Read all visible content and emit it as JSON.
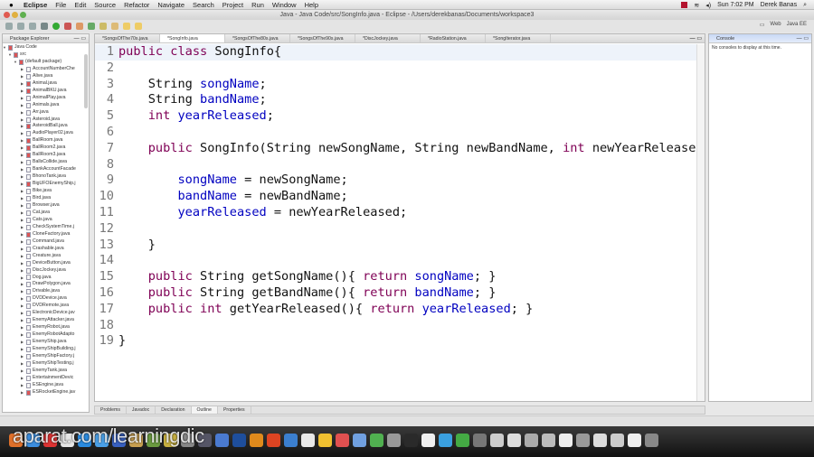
{
  "menubar": {
    "app": "Eclipse",
    "items": [
      "File",
      "Edit",
      "Source",
      "Refactor",
      "Navigate",
      "Search",
      "Project",
      "Run",
      "Window",
      "Help"
    ],
    "clock": "Sun 7:02 PM",
    "user": "Derek Banas"
  },
  "window": {
    "title": "Java - Java Code/src/SongInfo.java - Eclipse - /Users/derekbanas/Documents/workspace3"
  },
  "perspectives": {
    "web": "Web",
    "javaee": "Java EE"
  },
  "package_explorer": {
    "title": "Package Explorer",
    "project": "Java Code",
    "src": "src",
    "package": "(default package)",
    "files": [
      "AccountNumberChe",
      "Alive.java",
      "Animal.java",
      "AnimalBKU.java",
      "AnimalPlay.java",
      "Animals.java",
      "Arr.java",
      "Asteroid.java",
      "AsteroidBall.java",
      "AudioPlayer02.java",
      "BallRoom.java",
      "BallRoom2.java",
      "BallRoom3.java",
      "BallsCollide.java",
      "BankAccountFacade",
      "BhonoTank.java",
      "BigUFOEnemyShip.j",
      "Bike.java",
      "Bird.java",
      "Browser.java",
      "Cat.java",
      "Cats.java",
      "CheckSystemTime.j",
      "CloneFactory.java",
      "Command.java",
      "Crashable.java",
      "Creature.java",
      "DeviceButton.java",
      "DiscJockey.java",
      "Dog.java",
      "DrawPolygon.java",
      "Drivable.java",
      "DVDDevice.java",
      "DVDRemote.java",
      "ElectronicDevice.jav",
      "EnemyAttacker.java",
      "EnemyRobot.java",
      "EnemyRobotAdapto",
      "EnemyShip.java",
      "EnemyShipBuilding.j",
      "EnemyShipFactory.j",
      "EnemyShipTesting.j",
      "EnemyTank.java",
      "EntertainmentDevic",
      "ESEngine.java",
      "ESRocketEngine.jav"
    ],
    "error_files": [
      2,
      3,
      8,
      10,
      11,
      12,
      16,
      23,
      45
    ]
  },
  "editor": {
    "tabs": [
      "*SongsOfThe70s.java",
      "*SongInfo.java",
      "*SongsOfThe80s.java",
      "*SongsOfThe90s.java",
      "*DiscJockey.java",
      "*RadioStation.java",
      "*SongIterator.java"
    ],
    "active_tab": 1,
    "lines": [
      [
        [
          "public class ",
          "kw"
        ],
        [
          "SongInfo{",
          "tx"
        ]
      ],
      [],
      [
        [
          "    String ",
          "tx"
        ],
        [
          "songName",
          "fd"
        ],
        [
          ";",
          "tx"
        ]
      ],
      [
        [
          "    String ",
          "tx"
        ],
        [
          "bandName",
          "fd"
        ],
        [
          ";",
          "tx"
        ]
      ],
      [
        [
          "    int ",
          "kw"
        ],
        [
          "yearReleased",
          "fd"
        ],
        [
          ";",
          "tx"
        ]
      ],
      [],
      [
        [
          "    public ",
          "kw"
        ],
        [
          "SongInfo(String newSongName, String newBandName, ",
          "tx"
        ],
        [
          "int ",
          "kw"
        ],
        [
          "newYearRelease",
          "tx"
        ]
      ],
      [],
      [
        [
          "        songName",
          "fd"
        ],
        [
          " = newSongName;",
          "tx"
        ]
      ],
      [
        [
          "        bandName",
          "fd"
        ],
        [
          " = newBandName;",
          "tx"
        ]
      ],
      [
        [
          "        yearReleased",
          "fd"
        ],
        [
          " = newYearReleased;",
          "tx"
        ]
      ],
      [],
      [
        [
          "    }",
          "tx"
        ]
      ],
      [],
      [
        [
          "    public ",
          "kw"
        ],
        [
          "String getSongName(){ ",
          "tx"
        ],
        [
          "return ",
          "kw"
        ],
        [
          "songName",
          "fd"
        ],
        [
          "; }",
          "tx"
        ]
      ],
      [
        [
          "    public ",
          "kw"
        ],
        [
          "String getBandName(){ ",
          "tx"
        ],
        [
          "return ",
          "kw"
        ],
        [
          "bandName",
          "fd"
        ],
        [
          "; }",
          "tx"
        ]
      ],
      [
        [
          "    public int ",
          "kw"
        ],
        [
          "getYearReleased(){ ",
          "tx"
        ],
        [
          "return ",
          "kw"
        ],
        [
          "yearReleased",
          "fd"
        ],
        [
          "; }",
          "tx"
        ]
      ],
      [],
      [
        [
          "}",
          "tx"
        ]
      ]
    ]
  },
  "console": {
    "title": "Console",
    "message": "No consoles to display at this time."
  },
  "bottom_tabs": [
    "Problems",
    "Javadoc",
    "Declaration",
    "Outline",
    "Properties"
  ],
  "bottom_active": 3,
  "watermark": "aparat.com/learningdic",
  "dock_colors": [
    "#e0702a",
    "#3c8ee0",
    "#d33",
    "#e6e6e6",
    "#2a8be0",
    "#4aa0e8",
    "#3860c0",
    "#c9a050",
    "#6a9a40",
    "#c8b040",
    "#888",
    "#556",
    "#4a7ad0",
    "#1e4e9c",
    "#e08a1c",
    "#d42",
    "#3b7fd0",
    "#e8e8e8",
    "#f0c030",
    "#e05050",
    "#70a0e0",
    "#50b050",
    "#999",
    "#2a2a2a",
    "#f0f0f0",
    "#3aa0e0",
    "#4a4",
    "#777",
    "#ccc",
    "#ddd",
    "#aaa",
    "#bbb",
    "#eee",
    "#999",
    "#ddd",
    "#ccc",
    "#eee",
    "#888"
  ]
}
